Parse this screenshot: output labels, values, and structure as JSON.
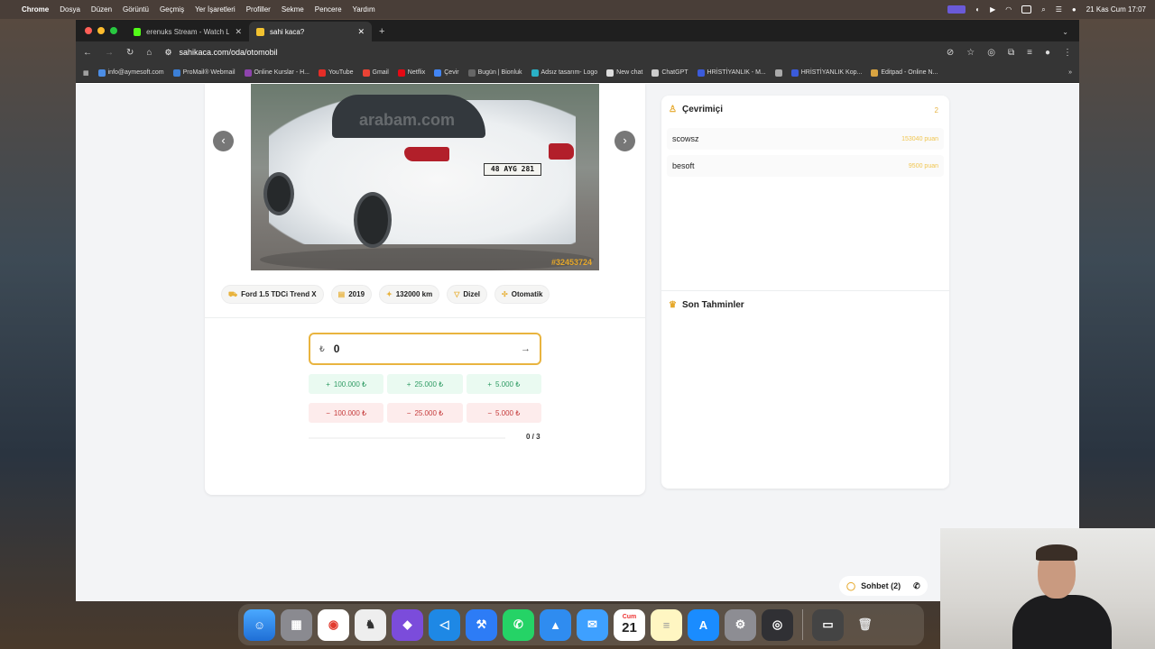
{
  "menubar": {
    "app": "Chrome",
    "items": [
      "Dosya",
      "Düzen",
      "Görüntü",
      "Geçmiş",
      "Yer İşaretleri",
      "Profiller",
      "Sekme",
      "Pencere",
      "Yardım"
    ],
    "clock": "21 Kas Cum 17:07"
  },
  "tabs": [
    {
      "label": "erenuks Stream - Watch Live",
      "active": false
    },
    {
      "label": "sahi kaca?",
      "active": true
    }
  ],
  "toolbar": {
    "url": "sahikaca.com/oda/otomobil"
  },
  "bookmarks": [
    "info@aymesoft.com",
    "ProMail® Webmail",
    "Online Kurslar - H...",
    "YouTube",
    "Gmail",
    "Netflix",
    "Çevir",
    "Bugün | Bionluk",
    "Adsız tasarım- Logo",
    "New chat",
    "ChatGPT",
    "HRİSTİYANLIK - M...",
    "",
    "HRİSTİYANLIK Kop...",
    "Editpad - Online N..."
  ],
  "car": {
    "plate": "48 AYG 281",
    "watermark": "arabam.com",
    "image_id": "#32453724"
  },
  "specs": [
    {
      "icon": "car-icon",
      "label": "Ford 1.5 TDCi Trend X"
    },
    {
      "icon": "calendar-icon",
      "label": "2019"
    },
    {
      "icon": "gauge-icon",
      "label": "132000 km"
    },
    {
      "icon": "fuel-icon",
      "label": "Dizel"
    },
    {
      "icon": "gear-icon",
      "label": "Otomatik"
    }
  ],
  "guess": {
    "currency": "₺",
    "value": "0"
  },
  "quick_buttons": {
    "plus": [
      "100.000 ₺",
      "25.000 ₺",
      "5.000 ₺"
    ],
    "minus": [
      "100.000 ₺",
      "25.000 ₺",
      "5.000 ₺"
    ]
  },
  "counter": "0 / 3",
  "online": {
    "title": "Çevrimiçi",
    "count": "2",
    "users": [
      {
        "name": "scowsz",
        "points": "153040 puan"
      },
      {
        "name": "besoft",
        "points": "9500 puan"
      }
    ]
  },
  "recent": {
    "title": "Son Tahminler"
  },
  "chat": {
    "label": "Sohbet (2)"
  },
  "dock_date": {
    "month": "Cum",
    "day": "21"
  },
  "colors": {
    "accent": "#e6a82a",
    "plus": "#2e9b63",
    "minus": "#c53b3b"
  }
}
